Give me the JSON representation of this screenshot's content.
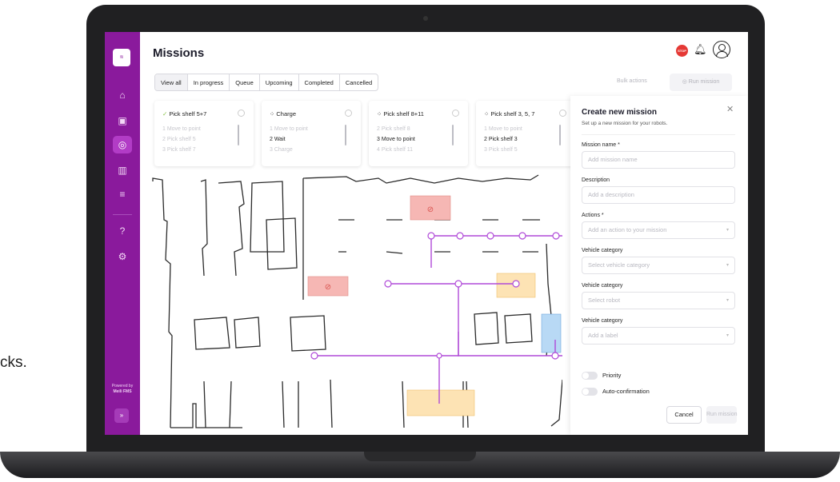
{
  "background_text": "cks.",
  "app": {
    "title": "Missions",
    "stop_badge": "STOP",
    "powered_by": "Powered by",
    "powered_name": "Meili FMS",
    "expand": "»"
  },
  "tabs": [
    "View all",
    "In progress",
    "Queue",
    "Upcoming",
    "Completed",
    "Cancelled"
  ],
  "actions": {
    "bulk": "Bulk actions",
    "run": "Run mission"
  },
  "cards": [
    {
      "title": "Pick shelf 5+7",
      "status_icon": "check",
      "steps": [
        "1  Move to point",
        "2  Pick shelf 5",
        "3  Pick shelf 7"
      ],
      "active_step": -1
    },
    {
      "title": "Charge",
      "status_icon": "spinner",
      "steps": [
        "1  Move to point",
        "2  Wait",
        "3  Charge"
      ],
      "active_step": 1
    },
    {
      "title": "Pick shelf 8+11",
      "status_icon": "spinner",
      "steps": [
        "2  Pick shelf 8",
        "3  Move to point",
        "4  Pick shelf 11"
      ],
      "active_step": 1
    },
    {
      "title": "Pick shelf 3, 5, 7",
      "status_icon": "spinner",
      "steps": [
        "1  Move to point",
        "2  Pick shelf 3",
        "3  Pick shelf 5"
      ],
      "active_step": 1
    }
  ],
  "panel": {
    "title": "Create new mission",
    "subtitle": "Set up a new mission for your robots.",
    "fields": [
      {
        "label": "Mission name *",
        "placeholder": "Add mission name",
        "dropdown": false
      },
      {
        "label": "Description",
        "placeholder": "Add a description",
        "dropdown": false
      },
      {
        "label": "Actions *",
        "placeholder": "Add an action to your mission",
        "dropdown": true
      },
      {
        "label": "Vehicle category",
        "placeholder": "Select vehicle category",
        "dropdown": true
      },
      {
        "label": "Vehicle category",
        "placeholder": "Select robot",
        "dropdown": true
      },
      {
        "label": "Vehicle category",
        "placeholder": "Add a label",
        "dropdown": true
      }
    ],
    "toggles": [
      "Priority",
      "Auto-confirmation"
    ],
    "cancel": "Cancel",
    "run": "Run mission"
  },
  "colors": {
    "brand": "#8a1a9c",
    "route": "#b04ad8",
    "zone_red": "#f3b5b2",
    "zone_yellow": "#fde3b4",
    "zone_blue": "#b8d9f5"
  }
}
